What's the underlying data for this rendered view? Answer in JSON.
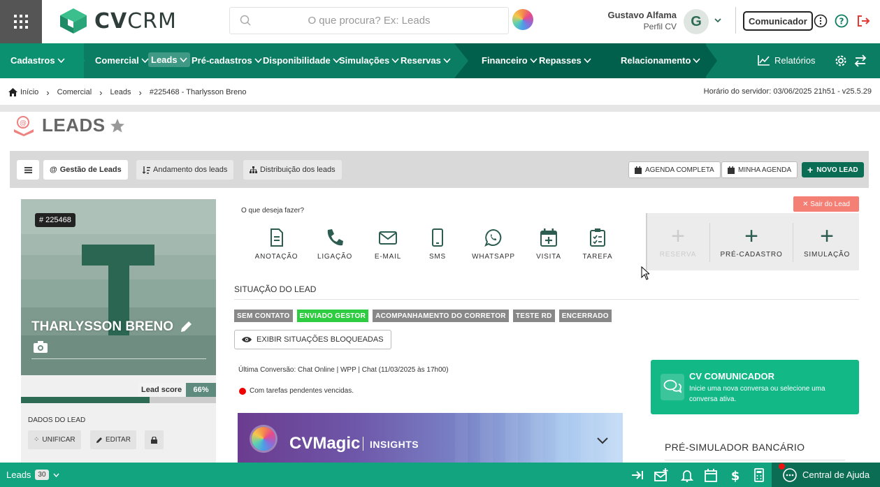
{
  "header": {
    "logo_text_bold": "CV",
    "logo_text_light": "CRM",
    "search_placeholder": "O que procura? Ex: Leads",
    "user_name": "Gustavo Alfama",
    "user_profile": "Perfil CV",
    "avatar_letter": "G",
    "comunicador_label": "Comunicador"
  },
  "menu": {
    "items": [
      {
        "label": "Cadastros"
      },
      {
        "label": "Comercial"
      },
      {
        "label": "Leads"
      },
      {
        "label": "Pré-cadastros"
      },
      {
        "label": "Disponibilidade"
      },
      {
        "label": "Simulações"
      },
      {
        "label": "Reservas"
      },
      {
        "label": "Financeiro"
      },
      {
        "label": "Repasses"
      },
      {
        "label": "Relacionamento"
      }
    ],
    "relatorios_label": "Relatórios",
    "active": "Leads",
    "colors": {
      "primary": "#0b7d62",
      "dark": "#00604b",
      "darker": "#0a5747"
    }
  },
  "breadcrumb": {
    "items": [
      "Início",
      "Comercial",
      "Leads",
      "#225468 - Tharlysson Breno"
    ],
    "server_time": "Horário do servidor: 03/06/2025 21h51 - v25.5.29"
  },
  "page": {
    "title": "LEADS"
  },
  "tabs": {
    "items": [
      {
        "label": "Gestão de Leads"
      },
      {
        "label": "Andamento dos leads"
      },
      {
        "label": "Distribuição dos leads"
      }
    ],
    "agenda_completa": "AGENDA COMPLETA",
    "minha_agenda": "MINHA AGENDA",
    "novo_lead": "NOVO LEAD"
  },
  "lead": {
    "id": "# 225468",
    "initial": "T",
    "name": "THARLYSSON BRENO",
    "score_label": "Lead score",
    "score_pct": "66%",
    "score_value": 0.66,
    "dados_label": "DADOS DO LEAD",
    "unificar": "UNIFICAR",
    "editar": "EDITAR"
  },
  "actions": {
    "question": "O que deseja fazer?",
    "items": [
      {
        "label": "ANOTAÇÃO",
        "icon": "file-text-icon"
      },
      {
        "label": "LIGAÇÃO",
        "icon": "phone-icon"
      },
      {
        "label": "E-MAIL",
        "icon": "mail-icon"
      },
      {
        "label": "SMS",
        "icon": "mobile-icon"
      },
      {
        "label": "WHATSAPP",
        "icon": "whatsapp-icon"
      },
      {
        "label": "VISITA",
        "icon": "calendar-plus-icon"
      },
      {
        "label": "TAREFA",
        "icon": "clipboard-check-icon"
      }
    ],
    "sair": "✕ Sair do Lead",
    "big": [
      {
        "label": "RESERVA",
        "disabled": true
      },
      {
        "label": "PRÉ-CADASTRO",
        "disabled": false
      },
      {
        "label": "SIMULAÇÃO",
        "disabled": false
      }
    ]
  },
  "situacao": {
    "title": "SITUAÇÃO DO LEAD",
    "chips": [
      {
        "label": "SEM CONTATO",
        "color": "#888888"
      },
      {
        "label": "ENVIADO GESTOR",
        "color": "#2ecc40"
      },
      {
        "label": "ACOMPANHAMENTO DO CORRETOR",
        "color": "#888888"
      },
      {
        "label": "TESTE RD",
        "color": "#888888"
      },
      {
        "label": "ENCERRADO",
        "color": "#888888"
      }
    ],
    "exibir": "EXIBIR SITUAÇÕES BLOQUEADAS",
    "ultima": "Última Conversão: Chat Online | WPP | Chat (11/03/2025 às 17h00)",
    "pendentes": "Com tarefas pendentes vencidas."
  },
  "cvmagic": {
    "title": "CVMagic",
    "subtitle": "INSIGHTS"
  },
  "comunicador": {
    "title": "CV COMUNICADOR",
    "text": "Inicie uma nova conversa ou selecione uma conversa ativa."
  },
  "presim": {
    "title": "PRÉ-SIMULADOR BANCÁRIO"
  },
  "bottom": {
    "leads_label": "Leads",
    "leads_count": "30",
    "help_label": "Central de Ajuda"
  }
}
